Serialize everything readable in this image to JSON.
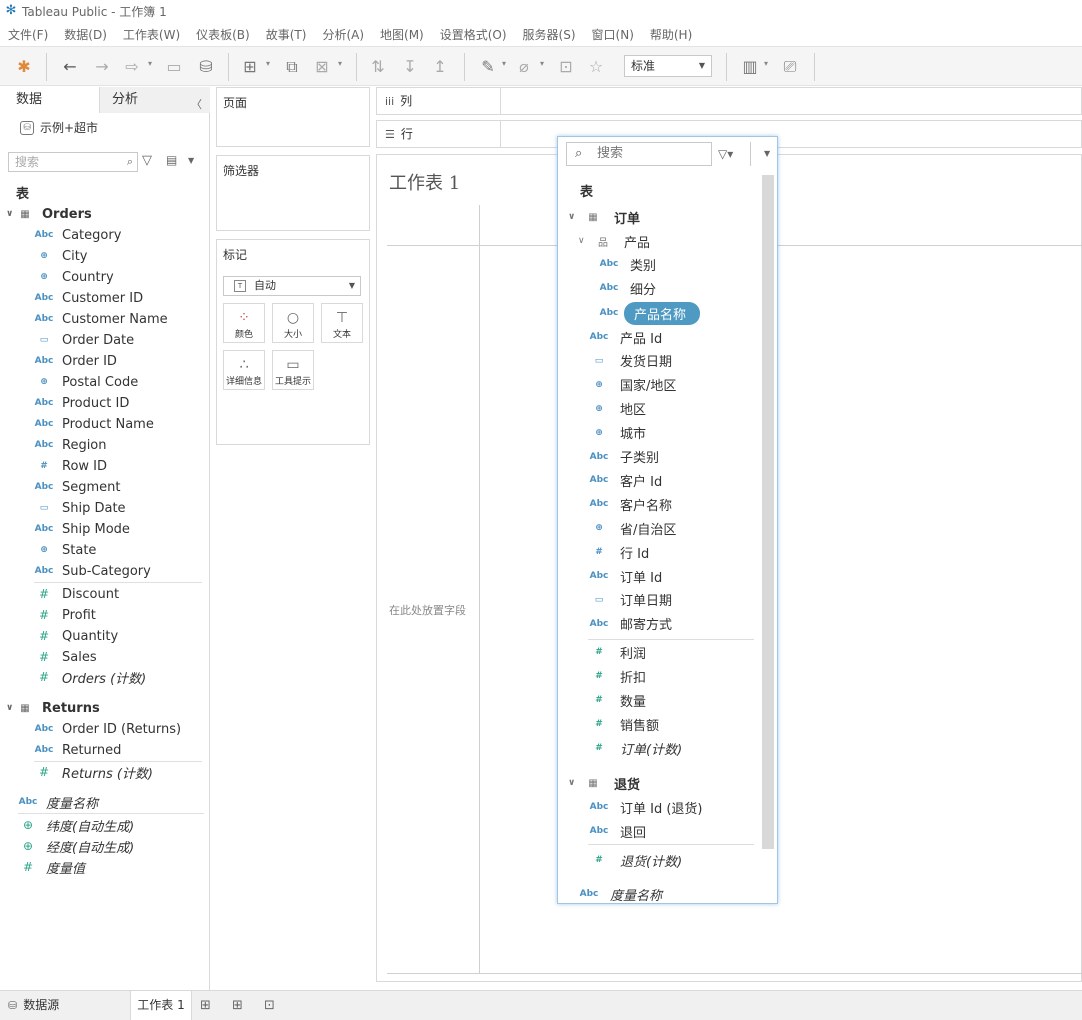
{
  "app": {
    "title": "Tableau Public - 工作簿 1"
  },
  "menu": [
    "文件(F)",
    "数据(D)",
    "工作表(W)",
    "仪表板(B)",
    "故事(T)",
    "分析(A)",
    "地图(M)",
    "设置格式(O)",
    "服务器(S)",
    "窗口(N)",
    "帮助(H)"
  ],
  "toolbar": {
    "fit_value": "标准"
  },
  "left_pane": {
    "tab_data": "数据",
    "tab_analysis": "分析",
    "datasource_name": "示例+超市",
    "search_placeholder": "搜索",
    "tables_header": "表",
    "orders": {
      "name": "Orders",
      "dimensions": [
        {
          "type": "Abc",
          "name": "Category"
        },
        {
          "type": "geo",
          "name": "City"
        },
        {
          "type": "geo",
          "name": "Country"
        },
        {
          "type": "Abc",
          "name": "Customer ID"
        },
        {
          "type": "Abc",
          "name": "Customer Name"
        },
        {
          "type": "date",
          "name": "Order Date"
        },
        {
          "type": "Abc",
          "name": "Order ID"
        },
        {
          "type": "geo",
          "name": "Postal Code"
        },
        {
          "type": "Abc",
          "name": "Product ID"
        },
        {
          "type": "Abc",
          "name": "Product Name"
        },
        {
          "type": "Abc",
          "name": "Region"
        },
        {
          "type": "#",
          "name": "Row ID"
        },
        {
          "type": "Abc",
          "name": "Segment"
        },
        {
          "type": "date",
          "name": "Ship Date"
        },
        {
          "type": "Abc",
          "name": "Ship Mode"
        },
        {
          "type": "geo",
          "name": "State"
        },
        {
          "type": "Abc",
          "name": "Sub-Category"
        }
      ],
      "measures": [
        "Discount",
        "Profit",
        "Quantity",
        "Sales"
      ],
      "count": "Orders (计数)"
    },
    "returns": {
      "name": "Returns",
      "dimensions": [
        "Order ID (Returns)",
        "Returned"
      ],
      "count": "Returns (计数)"
    },
    "measure_names": "度量名称",
    "latitude": "纬度(自动生成)",
    "longitude": "经度(自动生成)",
    "measure_values": "度量值"
  },
  "cards": {
    "pages": "页面",
    "filters": "筛选器",
    "marks": "标记",
    "mark_type": "自动",
    "color": "颜色",
    "size": "大小",
    "text": "文本",
    "detail": "详细信息",
    "tooltip": "工具提示"
  },
  "shelves": {
    "columns": "列",
    "rows": "行"
  },
  "canvas": {
    "sheet_title": "工作表 1",
    "drop_hint": "在此处放置字段"
  },
  "popup": {
    "search_placeholder": "搜索",
    "tables_header": "表",
    "orders_table": "订单",
    "product_group": "产品",
    "product_children": [
      "类别",
      "细分",
      "产品名称"
    ],
    "selected_field": "产品名称",
    "orders_fields": [
      {
        "type": "Abc",
        "name": "产品 Id"
      },
      {
        "type": "date",
        "name": "发货日期"
      },
      {
        "type": "geo",
        "name": "国家/地区"
      },
      {
        "type": "geo",
        "name": "地区"
      },
      {
        "type": "geo",
        "name": "城市"
      },
      {
        "type": "Abc",
        "name": "子类别"
      },
      {
        "type": "Abc",
        "name": "客户 Id"
      },
      {
        "type": "Abc",
        "name": "客户名称"
      },
      {
        "type": "geo",
        "name": "省/自治区"
      },
      {
        "type": "#",
        "name": "行 Id"
      },
      {
        "type": "Abc",
        "name": "订单 Id"
      },
      {
        "type": "date",
        "name": "订单日期"
      },
      {
        "type": "Abc",
        "name": "邮寄方式"
      }
    ],
    "orders_measures": [
      "利润",
      "折扣",
      "数量",
      "销售额"
    ],
    "orders_count": "订单(计数)",
    "returns_table": "退货",
    "returns_fields": [
      "订单 Id (退货)",
      "退回"
    ],
    "returns_count": "退货(计数)",
    "measure_names": "度量名称"
  },
  "bottom": {
    "datasource_tab": "数据源",
    "sheet_tab": "工作表 1"
  },
  "colors": {
    "dimension": "#4a90c2",
    "measure": "#2ca58a",
    "selected_pill": "#4e9ac2",
    "popup_border": "#9ec6e8"
  }
}
